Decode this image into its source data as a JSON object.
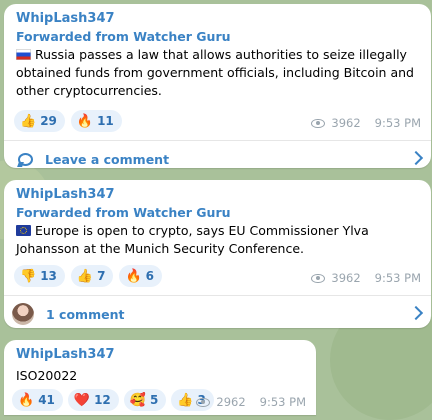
{
  "posts": [
    {
      "author": "WhipLash347",
      "forwarded": "Forwarded from Watcher Guru",
      "flag_icon": "russia-flag-icon",
      "text": "Russia passes a law that allows authorities to seize illegally obtained funds from government officials, including Bitcoin and other cryptocurrencies.",
      "reactions": [
        {
          "emoji": "👍",
          "icon": "thumbs-up-icon",
          "count": "29"
        },
        {
          "emoji": "🔥",
          "icon": "fire-icon",
          "count": "11"
        }
      ],
      "views": "3962",
      "time": "9:53 PM",
      "comment_label": "Leave a comment"
    },
    {
      "author": "WhipLash347",
      "forwarded": "Forwarded from Watcher Guru",
      "flag_icon": "eu-flag-icon",
      "text": "Europe is open to crypto, says EU Commissioner Ylva Johansson at the Munich Security Conference.",
      "reactions": [
        {
          "emoji": "👎",
          "icon": "thumbs-down-icon",
          "count": "13"
        },
        {
          "emoji": "👍",
          "icon": "thumbs-up-icon",
          "count": "7"
        },
        {
          "emoji": "🔥",
          "icon": "fire-icon",
          "count": "6"
        }
      ],
      "views": "3962",
      "time": "9:53 PM",
      "comment_label": "1 comment"
    },
    {
      "author": "WhipLash347",
      "text": "ISO20022",
      "reactions": [
        {
          "emoji": "🔥",
          "icon": "fire-icon",
          "count": "41"
        },
        {
          "emoji": "❤️",
          "icon": "heart-icon",
          "count": "12"
        },
        {
          "emoji": "🥰",
          "icon": "smiling-hearts-icon",
          "count": "5"
        },
        {
          "emoji": "👍",
          "icon": "thumbs-up-icon",
          "count": "3"
        }
      ],
      "views": "2962",
      "time": "9:53 PM"
    }
  ],
  "colors": {
    "accent": "#3a82c4",
    "chat_background": "#a9c19a",
    "reaction_chip": "#e8f1fb"
  }
}
